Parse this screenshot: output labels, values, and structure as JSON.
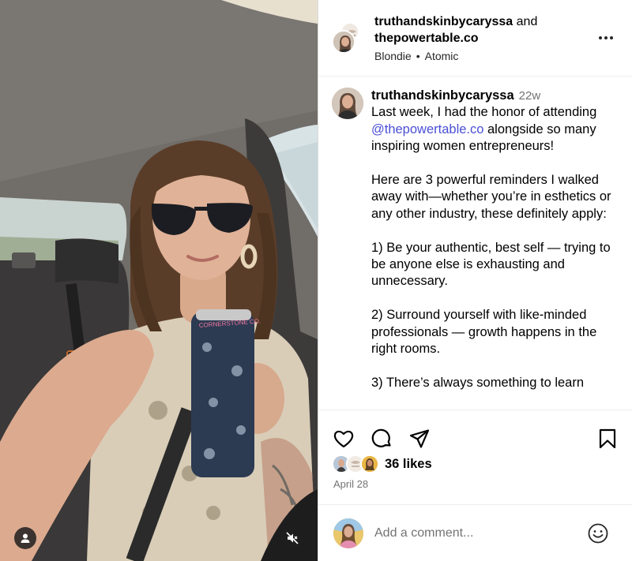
{
  "header": {
    "author": "truthandskinbycaryssa",
    "conjunction": "and",
    "collaborator": "thepowertable.co",
    "audio_artist": "Blondie",
    "audio_separator": "•",
    "audio_track": "Atomic"
  },
  "caption": {
    "username": "truthandskinbycaryssa",
    "time_ago": "22w",
    "line1": "Last week, I had the honor of attending ",
    "mention": "@thepowertable.co",
    "line2": " alongside so many inspiring women entrepreneurs!\n\nHere are 3 powerful reminders I walked away with—whether you’re in esthetics or any other industry, these definitely apply:\n\n1) Be your authentic, best self — trying to be anyone else is exhausting and unnecessary.\n\n2) Surround yourself with like-minded professionals — growth happens in the right rooms.\n\n3) There’s always something to learn"
  },
  "actions": {
    "like_icon": "heart-icon",
    "comment_icon": "comment-bubble-icon",
    "share_icon": "paper-plane-icon",
    "save_icon": "bookmark-icon",
    "likes": "36 likes",
    "date": "April 28"
  },
  "comment": {
    "placeholder": "Add a comment...",
    "emoji_icon": "smiley-face-icon"
  },
  "media": {
    "user_tag_icon": "person-icon",
    "mute_icon": "speaker-muted-icon",
    "can_text": "CORNERSTONE CO."
  },
  "colors": {
    "mention": "#4b4fd6",
    "secondary_text": "#737373",
    "divider": "#efefef"
  }
}
